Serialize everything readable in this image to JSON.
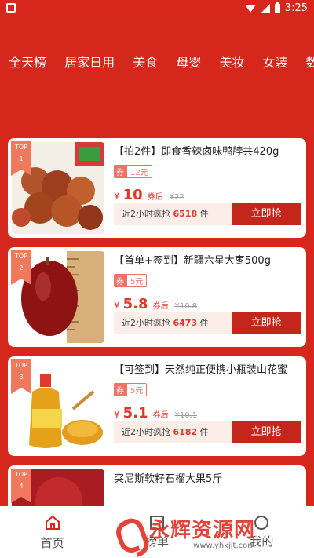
{
  "status_bar": {
    "time": "3:25"
  },
  "categories": [
    "全天榜",
    "居家日用",
    "美食",
    "母婴",
    "美妆",
    "女装",
    "数码"
  ],
  "products": [
    {
      "rank_label": "TOP",
      "rank": "1",
      "title": "【拍2件】即食香辣卤味鸭脖共420g",
      "coupon_label": "券",
      "coupon_value": "12元",
      "currency": "¥",
      "price": "10",
      "after_coupon": "券后",
      "original_price": "¥22",
      "sales_prefix": "近2小时疯抢",
      "sales_count": "6518",
      "sales_unit": "件",
      "button": "立即抢"
    },
    {
      "rank_label": "TOP",
      "rank": "2",
      "title": "【首单+签到】新疆六星大枣500g",
      "coupon_label": "券",
      "coupon_value": "5元",
      "currency": "¥",
      "price": "5.8",
      "after_coupon": "券后",
      "original_price": "¥10.8",
      "sales_prefix": "近2小时疯抢",
      "sales_count": "6473",
      "sales_unit": "件",
      "button": "立即抢"
    },
    {
      "rank_label": "TOP",
      "rank": "3",
      "title": "【可签到】天然纯正便携小瓶装山花蜜",
      "coupon_label": "券",
      "coupon_value": "5元",
      "currency": "¥",
      "price": "5.1",
      "after_coupon": "券后",
      "original_price": "¥10.1",
      "sales_prefix": "近2小时疯抢",
      "sales_count": "6182",
      "sales_unit": "件",
      "button": "立即抢"
    },
    {
      "rank_label": "TOP",
      "rank": "4",
      "title": "突尼斯软籽石榴大果5斤"
    }
  ],
  "bottom_nav": [
    {
      "label": "首页",
      "icon": "home-icon"
    },
    {
      "label": "榜单",
      "icon": "list-icon"
    },
    {
      "label": "我的",
      "icon": "user-icon"
    }
  ],
  "watermark": {
    "brand": "永辉资源网",
    "url": "www.yhkjjt.com"
  },
  "colors": {
    "primary": "#d5271b",
    "accent": "#e0372b",
    "badge": "#f0785d",
    "button": "#c5261b"
  }
}
